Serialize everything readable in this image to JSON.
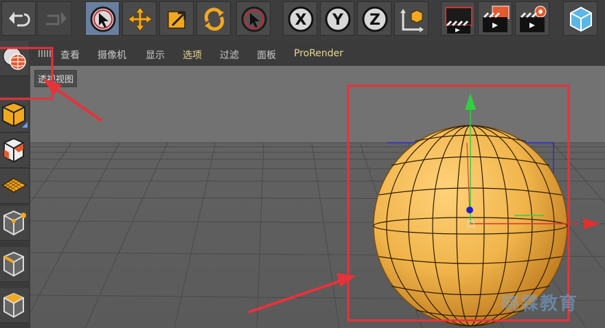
{
  "toolbar": {
    "undo": "undo-icon",
    "redo": "redo-icon",
    "tools": [
      "select",
      "move",
      "scale",
      "rotate",
      "live-select"
    ],
    "axes": [
      "X",
      "Y",
      "Z"
    ]
  },
  "menu": {
    "items": [
      "查看",
      "摄像机",
      "显示",
      "选项",
      "过滤",
      "面板",
      "ProRender"
    ],
    "active_index": 3
  },
  "viewport": {
    "label": "透视视图"
  },
  "watermark": "晓霖教育",
  "colors": {
    "sphere": "#f0b44a",
    "sphere_shadow": "#b9741b",
    "highlight_frame": "#e8323a",
    "axis_x": "#e03030",
    "axis_y": "#2fd040",
    "axis_z": "#2020d0",
    "menu_active": "#e8d898"
  }
}
